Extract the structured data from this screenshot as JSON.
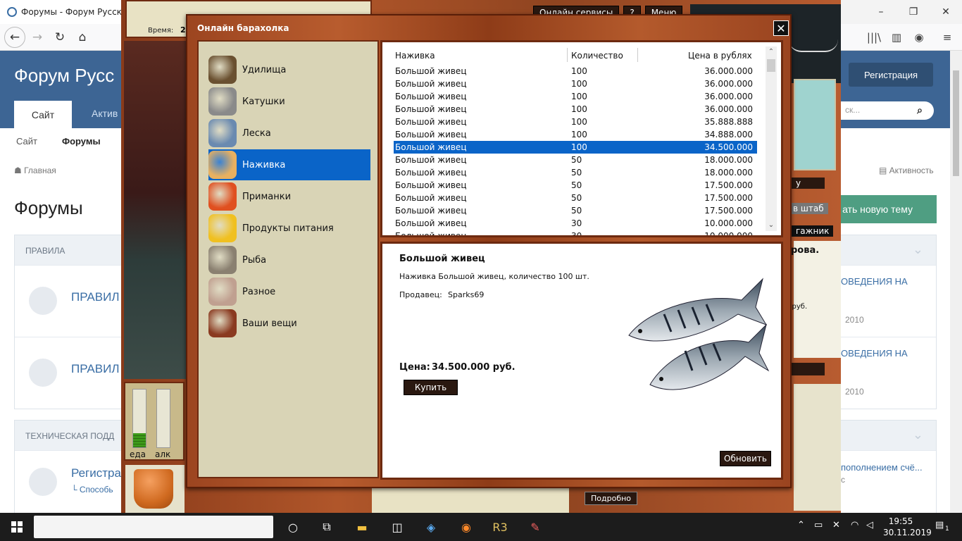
{
  "browser": {
    "tab_title": "Форумы - Форум Русско",
    "min": "–",
    "max": "❐",
    "close": "✕",
    "back": "←",
    "forward": "→",
    "reload": "↻",
    "home": "⌂",
    "library": "|||\\",
    "sidebar": "▥",
    "account": "◉",
    "menu": "≡"
  },
  "forum": {
    "title": "Форум Русс",
    "tab_site": "Сайт",
    "tab_activity": "Актив",
    "register": "Регистрация",
    "search_placeholder": "ск...",
    "subnav_site": "Сайт",
    "subnav_forums": "Форумы",
    "crumb_home": "☗ Главная",
    "crumb_activity": "▤ Активность",
    "h1": "Форумы",
    "new_topic": "ать новую тему",
    "cat1": "ПРАВИЛА",
    "cat1_row1": "ПРАВИЛ",
    "cat1_row2": "ПРАВИЛ",
    "cat2": "ТЕХНИЧЕСКАЯ ПОДД",
    "cat2_row1": "Регистра",
    "cat2_row1_sub": "└ Способь",
    "right1": "ОВЕДЕНИЯ НА",
    "right1_year": "2010",
    "right2": "ОВЕДЕНИЯ НА",
    "right2_year": "2010",
    "right3": "пополнением счё...",
    "right3_sub": "с",
    "rova": "рова.",
    "rub": "0 руб.",
    "chev": "⌄"
  },
  "game": {
    "time_label": "Время:",
    "time_value": "2",
    "btn_online": "Онлайн сервисы",
    "btn_help": "?",
    "btn_menu": "Меню",
    "side_y": "у",
    "side_shtab": "в штаб",
    "side_bagazh": "гажник",
    "meter_food": "еда",
    "meter_alc": "алк",
    "more": "Подробно"
  },
  "market": {
    "title": "Онлайн барахолка",
    "close": "✕",
    "categories": [
      {
        "label": "Удилища",
        "icon": "fishing-rod-icon"
      },
      {
        "label": "Катушки",
        "icon": "reel-icon"
      },
      {
        "label": "Леска",
        "icon": "fishing-line-icon"
      },
      {
        "label": "Наживка",
        "icon": "bait-icon",
        "selected": true
      },
      {
        "label": "Приманки",
        "icon": "lure-icon"
      },
      {
        "label": "Продукты питания",
        "icon": "cheese-icon"
      },
      {
        "label": "Рыба",
        "icon": "fish-icon"
      },
      {
        "label": "Разное",
        "icon": "misc-icon"
      },
      {
        "label": "Ваши вещи",
        "icon": "suitcase-icon"
      }
    ],
    "columns": [
      "Наживка",
      "Количество",
      "Цена в рублях"
    ],
    "rows": [
      {
        "name": "Большой живец",
        "qty": "100",
        "price": "36.000.000"
      },
      {
        "name": "Большой живец",
        "qty": "100",
        "price": "36.000.000"
      },
      {
        "name": "Большой живец",
        "qty": "100",
        "price": "36.000.000"
      },
      {
        "name": "Большой живец",
        "qty": "100",
        "price": "36.000.000"
      },
      {
        "name": "Большой живец",
        "qty": "100",
        "price": "35.888.888"
      },
      {
        "name": "Большой живец",
        "qty": "100",
        "price": "34.888.000"
      },
      {
        "name": "Большой живец",
        "qty": "100",
        "price": "34.500.000",
        "selected": true
      },
      {
        "name": "Большой живец",
        "qty": "50",
        "price": "18.000.000"
      },
      {
        "name": "Большой живец",
        "qty": "50",
        "price": "18.000.000"
      },
      {
        "name": "Большой живец",
        "qty": "50",
        "price": "17.500.000"
      },
      {
        "name": "Большой живец",
        "qty": "50",
        "price": "17.500.000"
      },
      {
        "name": "Большой живец",
        "qty": "50",
        "price": "17.500.000"
      },
      {
        "name": "Большой живец",
        "qty": "30",
        "price": "10.000.000"
      },
      {
        "name": "Большой живец",
        "qty": "30",
        "price": "10.000.000"
      }
    ],
    "detail": {
      "name": "Большой живец",
      "desc": "Наживка Большой живец, количество 100 шт.",
      "seller_label": "Продавец:",
      "seller": "Sparks69",
      "price_label": "Цена:",
      "price": "34.500.000 руб.",
      "buy": "Купить",
      "refresh": "Обновить"
    }
  },
  "taskbar": {
    "time": "19:55",
    "date": "30.11.2019",
    "notif_count": "1"
  },
  "colors": {
    "selection": "#0a64c8",
    "wood_dark": "#6d2a10",
    "forum_blue": "#3d6594"
  }
}
